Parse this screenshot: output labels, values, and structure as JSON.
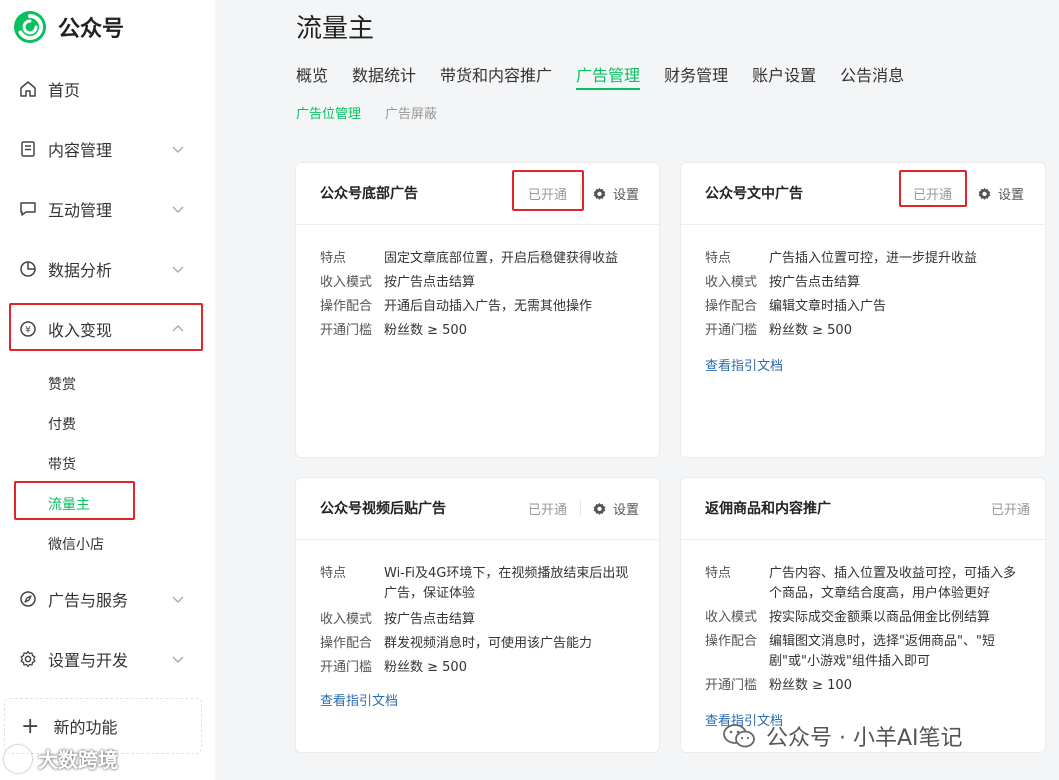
{
  "brand": {
    "name": "公众号"
  },
  "sidebar": {
    "items": [
      {
        "label": "首页"
      },
      {
        "label": "内容管理"
      },
      {
        "label": "互动管理"
      },
      {
        "label": "数据分析"
      },
      {
        "label": "收入变现"
      },
      {
        "label": "广告与服务"
      },
      {
        "label": "设置与开发"
      }
    ],
    "sub_items": [
      {
        "label": "赞赏"
      },
      {
        "label": "付费"
      },
      {
        "label": "带货"
      },
      {
        "label": "流量主"
      },
      {
        "label": "微信小店"
      }
    ],
    "new_feature": "新的功能"
  },
  "page": {
    "title": "流量主",
    "tabs": [
      {
        "label": "概览"
      },
      {
        "label": "数据统计"
      },
      {
        "label": "带货和内容推广"
      },
      {
        "label": "广告管理"
      },
      {
        "label": "财务管理"
      },
      {
        "label": "账户设置"
      },
      {
        "label": "公告消息"
      }
    ],
    "subtabs": [
      {
        "label": "广告位管理"
      },
      {
        "label": "广告屏蔽"
      }
    ]
  },
  "cards": [
    {
      "title": "公众号底部广告",
      "status": "已开通",
      "settings": "设置",
      "rows": [
        {
          "k": "特点",
          "v": "固定文章底部位置，开启后稳健获得收益"
        },
        {
          "k": "收入模式",
          "v": "按广告点击结算"
        },
        {
          "k": "操作配合",
          "v": "开通后自动插入广告，无需其他操作"
        },
        {
          "k": "开通门槛",
          "v": "粉丝数 ≥ 500"
        }
      ]
    },
    {
      "title": "公众号文中广告",
      "status": "已开通",
      "settings": "设置",
      "rows": [
        {
          "k": "特点",
          "v": "广告插入位置可控，进一步提升收益"
        },
        {
          "k": "收入模式",
          "v": "按广告点击结算"
        },
        {
          "k": "操作配合",
          "v": "编辑文章时插入广告"
        },
        {
          "k": "开通门槛",
          "v": "粉丝数 ≥ 500"
        }
      ],
      "link": "查看指引文档"
    },
    {
      "title": "公众号视频后贴广告",
      "status": "已开通",
      "settings": "设置",
      "rows": [
        {
          "k": "特点",
          "v": "Wi-Fi及4G环境下，在视频播放结束后出现广告，保证体验"
        },
        {
          "k": "收入模式",
          "v": "按广告点击结算"
        },
        {
          "k": "操作配合",
          "v": "群发视频消息时，可使用该广告能力"
        },
        {
          "k": "开通门槛",
          "v": "粉丝数 ≥ 500"
        }
      ],
      "link": "查看指引文档"
    },
    {
      "title": "返佣商品和内容推广",
      "status": "已开通",
      "rows": [
        {
          "k": "特点",
          "v": "广告内容、插入位置及收益可控，可插入多个商品，文章结合度高，用户体验更好"
        },
        {
          "k": "收入模式",
          "v": "按实际成交金额乘以商品佣金比例结算"
        },
        {
          "k": "操作配合",
          "v": "编辑图文消息时，选择\"返佣商品\"、\"短剧\"或\"小游戏\"组件插入即可"
        },
        {
          "k": "开通门槛",
          "v": "粉丝数 ≥ 100"
        }
      ],
      "link": "查看指引文档"
    }
  ],
  "watermarks": {
    "left": "大数跨境",
    "right": "公众号 · 小羊AI笔记"
  },
  "colors": {
    "accent": "#07c160",
    "highlight": "#e0242a",
    "link": "#2b6cb0"
  }
}
